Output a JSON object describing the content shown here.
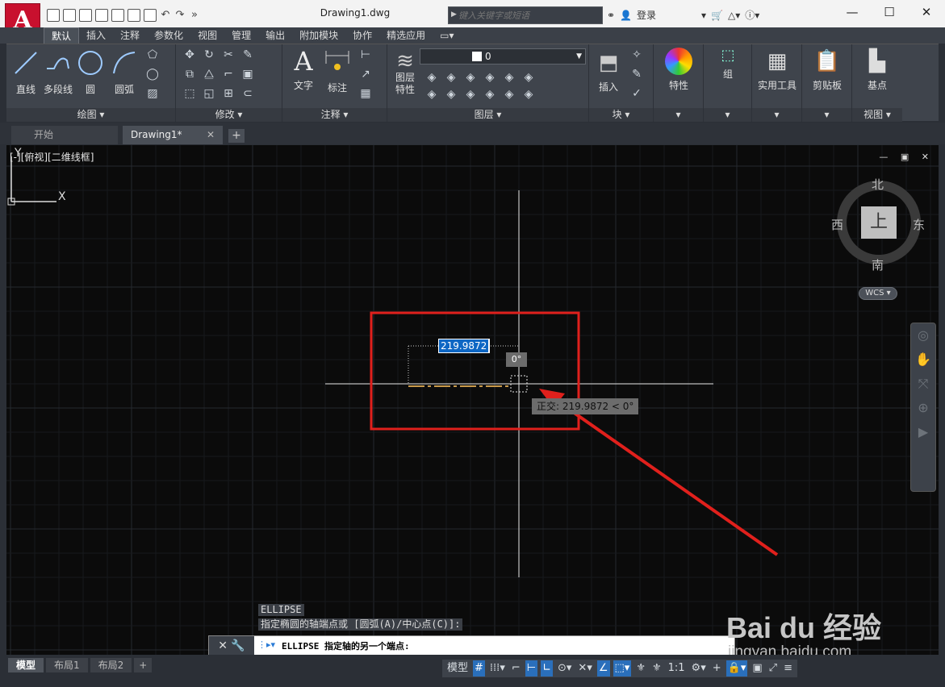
{
  "app": {
    "logo_letter": "A",
    "document_title": "Drawing1.dwg"
  },
  "search": {
    "placeholder": "键入关键字或短语"
  },
  "titlebar": {
    "login": "登录"
  },
  "ribbon_tabs": [
    "默认",
    "插入",
    "注释",
    "参数化",
    "视图",
    "管理",
    "输出",
    "附加模块",
    "协作",
    "精选应用"
  ],
  "panels": {
    "draw": {
      "title": "绘图 ▾",
      "tools": [
        "直线",
        "多段线",
        "圆",
        "圆弧"
      ]
    },
    "modify": {
      "title": "修改 ▾"
    },
    "annotation": {
      "title": "注释 ▾",
      "tools": [
        "文字",
        "标注"
      ]
    },
    "layers": {
      "title": "图层 ▾",
      "tool": "图层\n特性",
      "current_layer": "0"
    },
    "block": {
      "title": "块 ▾",
      "tool": "插入"
    },
    "properties": {
      "tool": "特性"
    },
    "group": {
      "tool": "组"
    },
    "utilities": {
      "tool": "实用工具"
    },
    "clipboard": {
      "tool": "剪贴板"
    },
    "view": {
      "title": "视图 ▾",
      "tool": "基点"
    }
  },
  "doc_tabs": [
    {
      "label": "开始"
    },
    {
      "label": "Drawing1*"
    }
  ],
  "viewport": {
    "label": "[-][俯视][二维线框]",
    "compass": {
      "north": "北",
      "south": "南",
      "east": "东",
      "west": "西",
      "top": "上"
    },
    "wcs": "WCS"
  },
  "dynamic_input": {
    "length": "219.9872",
    "angle": "0°",
    "ortho_tip": "正交: 219.9872 < 0°"
  },
  "command": {
    "history": [
      "ELLIPSE",
      "指定椭圆的轴端点或 [圆弧(A)/中心点(C)]:"
    ],
    "current": "ELLIPSE 指定轴的另一个端点:"
  },
  "ucs": {
    "x": "X",
    "y": "Y"
  },
  "layout_tabs": [
    "模型",
    "布局1",
    "布局2"
  ],
  "status": {
    "model": "模型",
    "scale": "1:1"
  },
  "watermark": {
    "main": "Bai du 经验",
    "sub": "jingyan.baidu.com"
  },
  "colors": {
    "accent": "#c8102e",
    "annotation_red": "#e0201c",
    "selection_blue": "#0e67c4"
  }
}
